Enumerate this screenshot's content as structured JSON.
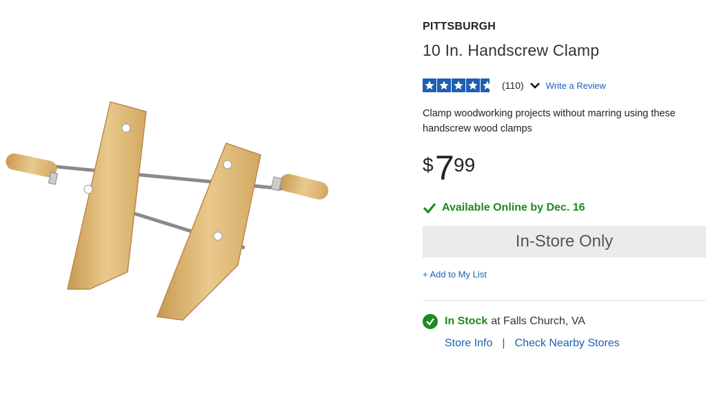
{
  "product": {
    "brand": "PITTSBURGH",
    "title": "10 In. Handscrew Clamp",
    "rating_value": 4.5,
    "review_count": "(110)",
    "write_review": "Write a Review",
    "description": "Clamp woodworking projects without marring using these handscrew wood clamps",
    "price": {
      "symbol": "$",
      "dollars": "7",
      "cents": "99"
    },
    "availability": "Available Online by Dec. 16",
    "instore_button": "In-Store Only",
    "add_to_list": "+ Add to My List",
    "stock_status": "In Stock",
    "stock_location": "at Falls Church, VA",
    "store_info": "Store Info",
    "separator": "|",
    "check_nearby": "Check Nearby Stores"
  },
  "icons": {
    "rating": "star-icon",
    "expand": "chevron-down-icon",
    "available": "checkmark-icon",
    "in_stock": "check-circle-icon"
  },
  "colors": {
    "link_blue": "#1c5fb3",
    "success_green": "#1d8a1d",
    "button_gray": "#ebebeb"
  }
}
